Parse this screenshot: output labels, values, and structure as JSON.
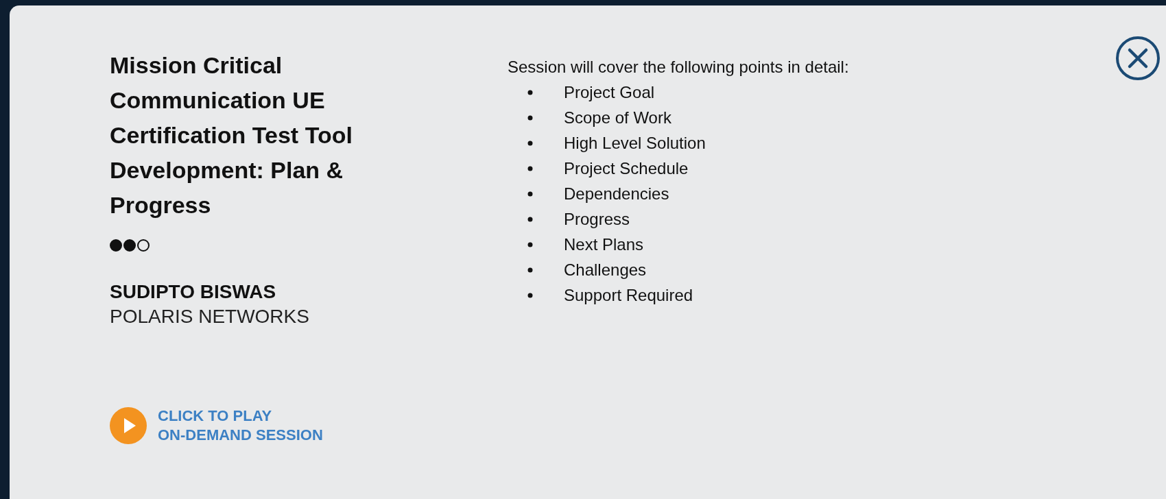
{
  "session": {
    "title": "Mission Critical Communication UE Certification Test Tool Development: Plan & Progress",
    "stars": 2,
    "speaker": "SUDIPTO BISWAS",
    "company": "POLARIS NETWORKS",
    "play_link": {
      "lines": [
        "CLICK TO PLAY",
        "ON-DEMAND SESSION"
      ]
    },
    "intro": "Session will cover the following points in detail:",
    "points": [
      "Project Goal",
      "Scope of Work",
      "High Level Solution",
      "Project Schedule",
      "Dependencies",
      "Progress",
      "Next Plans",
      "Challenges",
      "Support Required"
    ]
  }
}
